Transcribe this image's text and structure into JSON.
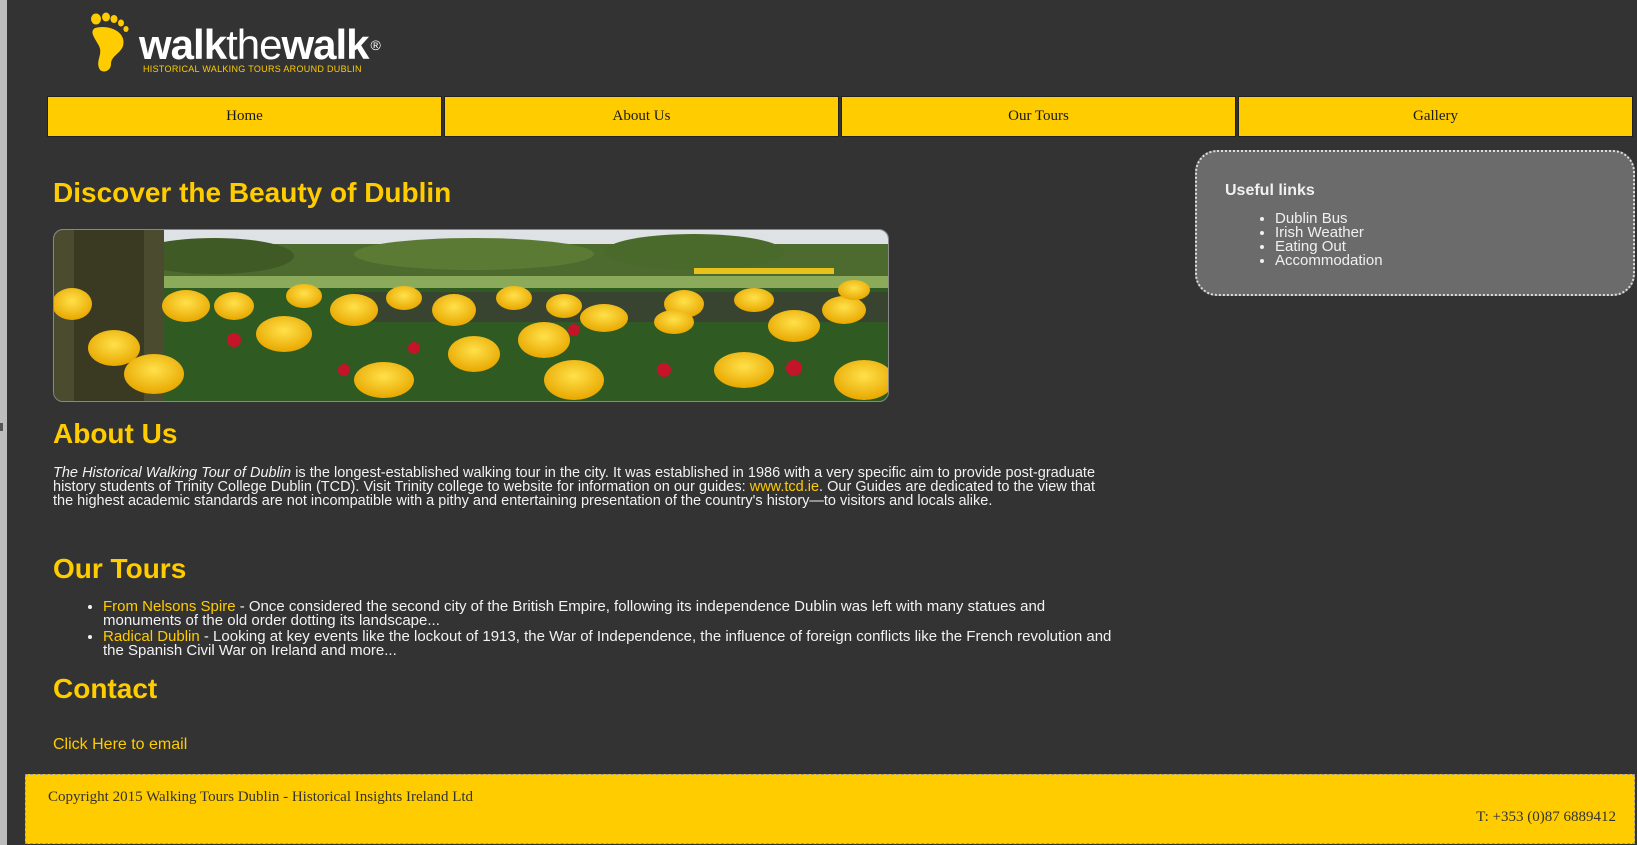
{
  "brand": {
    "name_bold_1": "walk",
    "name_thin": "the",
    "name_bold_2": "walk",
    "registered": "®",
    "tagline": "HISTORICAL WALKING TOURS AROUND DUBLIN",
    "logo_icon": "footprint-icon"
  },
  "nav": {
    "items": [
      {
        "label": "Home"
      },
      {
        "label": "About Us"
      },
      {
        "label": "Our Tours"
      },
      {
        "label": "Gallery"
      }
    ]
  },
  "main": {
    "discover_heading": "Discover the Beauty of Dublin",
    "hero_alt": "tulips-photo",
    "about": {
      "heading": "About Us",
      "tour_name": "The Historical Walking Tour of Dublin",
      "text_1": " is the longest-established walking tour in the city. It was established in 1986 with a very specific aim to provide post-graduate history students of Trinity College Dublin (TCD). Visit Trinity college to website for information on our guides: ",
      "link": "www.tcd.ie",
      "text_2": ". Our Guides are dedicated to the view that the highest academic standards are not incompatible with a pithy and entertaining presentation of the country's history—to visitors and locals alike."
    },
    "tours": {
      "heading": "Our Tours",
      "items": [
        {
          "link": "From Nelsons Spire",
          "desc": " - Once considered the second city of the British Empire, following its independence Dublin was left with many statues and monuments of the old order dotting its landscape..."
        },
        {
          "link": "Radical Dublin",
          "desc": " - Looking at key events like the lockout of 1913, the War of Independence, the influence of foreign conflicts like the French revolution and the Spanish Civil War on Ireland and more..."
        }
      ]
    },
    "contact": {
      "heading": "Contact",
      "email_link": "Click Here to email"
    }
  },
  "sidebar": {
    "title": "Useful links",
    "links": [
      {
        "label": "Dublin Bus"
      },
      {
        "label": "Irish Weather"
      },
      {
        "label": "Eating Out"
      },
      {
        "label": "Accommodation"
      }
    ]
  },
  "footer": {
    "copyright": "Copyright 2015 Walking Tours Dublin - Historical Insights Ireland Ltd",
    "phone": "T: +353 (0)87 6889412"
  },
  "colors": {
    "accent": "#ffcc00",
    "background": "#333333",
    "sidebar_bg": "#6b6b6b"
  }
}
